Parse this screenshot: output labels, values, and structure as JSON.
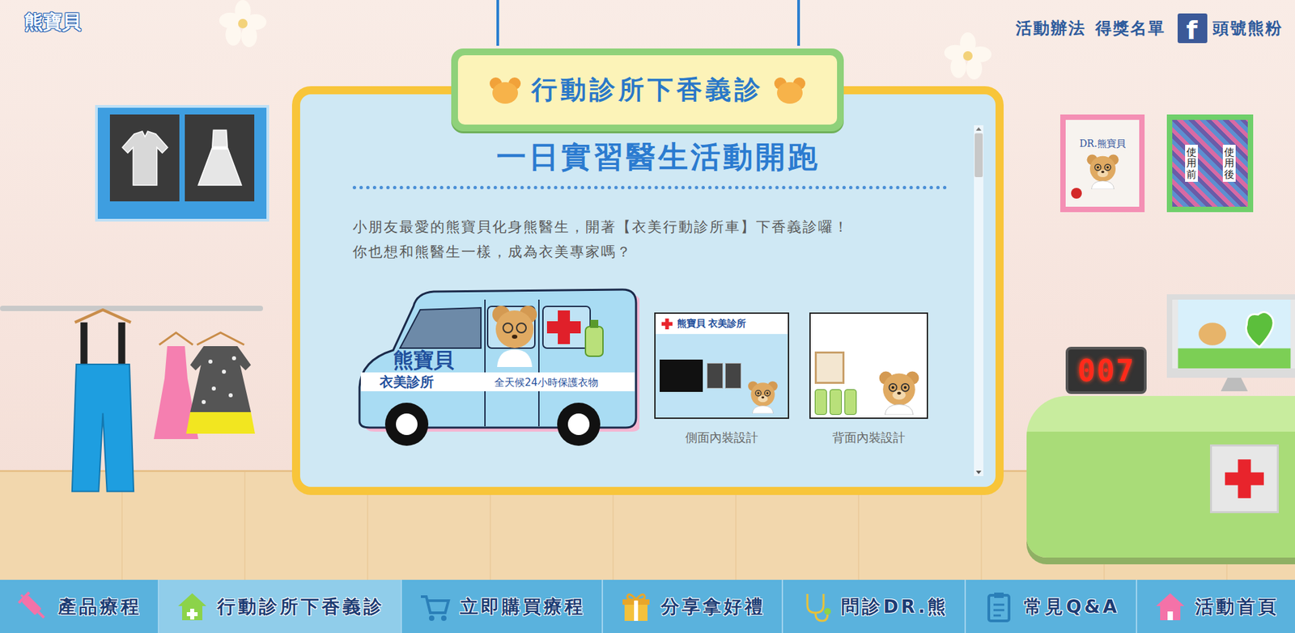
{
  "logo": "熊寶貝",
  "top_links": [
    {
      "label": "活動辦法",
      "kind": "text"
    },
    {
      "label": "得獎名單",
      "kind": "text"
    },
    {
      "label": "頭號熊粉",
      "kind": "facebook",
      "icon": "f"
    }
  ],
  "sign": {
    "title": "行動診所下香義診"
  },
  "article": {
    "heading": "一日實習醫生活動開跑",
    "paragraphs": [
      "小朋友最愛的熊寶貝化身熊醫生，開著【衣美行動診所車】下香義診囉！",
      "你也想和熊醫生一樣，成為衣美專家嗎？"
    ],
    "van": {
      "brand": "熊寶貝",
      "clinic": "衣美診所",
      "slogan": "全天候24小時保護衣物"
    },
    "images": [
      {
        "caption": "側面內裝設計",
        "header": "熊寶貝 衣美診所",
        "kind": "side"
      },
      {
        "caption": "背面內裝設計",
        "header": "",
        "kind": "back"
      }
    ]
  },
  "scrollbar": {
    "level": 0.13
  },
  "certificate": {
    "title": "DR.熊寶貝"
  },
  "before_after": {
    "before": "使用前",
    "after": "使用後"
  },
  "counter": {
    "number": "007"
  },
  "nav": [
    {
      "label": "產品療程",
      "selected": false
    },
    {
      "label": "行動診所下香義診",
      "selected": true
    },
    {
      "label": "立即購買療程",
      "selected": false
    },
    {
      "label": "分享拿好禮",
      "selected": false
    },
    {
      "label": "問診DR.熊",
      "selected": false
    },
    {
      "label": "常見Q&A",
      "selected": false
    },
    {
      "label": "活動首頁",
      "selected": false
    }
  ]
}
